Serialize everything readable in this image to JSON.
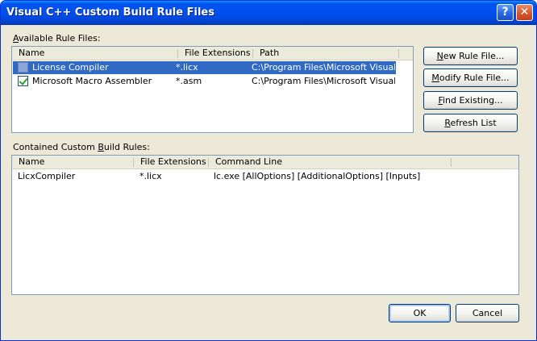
{
  "window": {
    "title": "Visual C++ Custom Build Rule Files",
    "help_glyph": "?",
    "close_glyph": "✕"
  },
  "available": {
    "label": "Available Rule Files:",
    "label_hotkey": "A",
    "label_rest": "vailable Rule Files:",
    "columns": [
      "Name",
      "File Extensions",
      "Path"
    ],
    "rows": [
      {
        "checked": false,
        "selected": true,
        "name": "License Compiler",
        "ext": "*.licx",
        "path": "C:\\Program Files\\Microsoft Visual ..."
      },
      {
        "checked": true,
        "selected": false,
        "name": "Microsoft Macro Assembler",
        "ext": "*.asm",
        "path": "C:\\Program Files\\Microsoft Visual ..."
      }
    ]
  },
  "buttons": {
    "new_rule_hotkey": "N",
    "new_rule_rest": "ew Rule File...",
    "modify_rule_hotkey": "M",
    "modify_rule_rest": "odify Rule File...",
    "find_existing_hotkey": "F",
    "find_existing_rest": "ind Existing...",
    "refresh_hotkey": "R",
    "refresh_rest": "efresh List",
    "ok": "OK",
    "cancel": "Cancel"
  },
  "contained": {
    "label_pre": "Contained Custom ",
    "label_hotkey": "B",
    "label_post": "uild Rules:",
    "columns": [
      "Name",
      "File Extensions",
      "Command Line"
    ],
    "rows": [
      {
        "name": "LicxCompiler",
        "ext": "*.licx",
        "command": "lc.exe [AllOptions] [AdditionalOptions] [Inputs]"
      }
    ]
  }
}
